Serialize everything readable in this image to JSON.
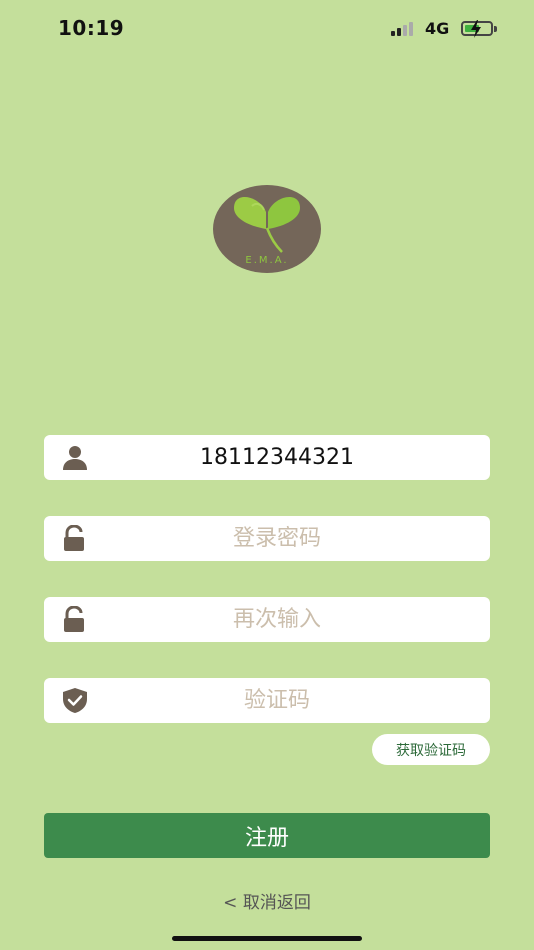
{
  "status_bar": {
    "time": "10:19",
    "network": "4G",
    "battery_level": 0.65,
    "icons": [
      "signal-icon",
      "battery-charging-icon"
    ]
  },
  "logo": {
    "text": "E.M.A.",
    "colors": {
      "badge": "#746659",
      "leaf": "#8ec63f"
    }
  },
  "form": {
    "phone": {
      "value": "18112344321",
      "placeholder": "",
      "icon": "user-icon"
    },
    "password": {
      "value": "",
      "placeholder": "登录密码",
      "icon": "lock-icon"
    },
    "password_confirm": {
      "value": "",
      "placeholder": "再次输入",
      "icon": "lock-icon"
    },
    "verification_code": {
      "value": "",
      "placeholder": "验证码",
      "icon": "shield-check-icon"
    }
  },
  "buttons": {
    "get_code": "获取验证码",
    "register": "注册",
    "cancel": "< 取消返回"
  },
  "colors": {
    "background": "#c4df9b",
    "primary": "#3d8b4c",
    "icon": "#6b5e52",
    "placeholder": "#cbbeac"
  }
}
